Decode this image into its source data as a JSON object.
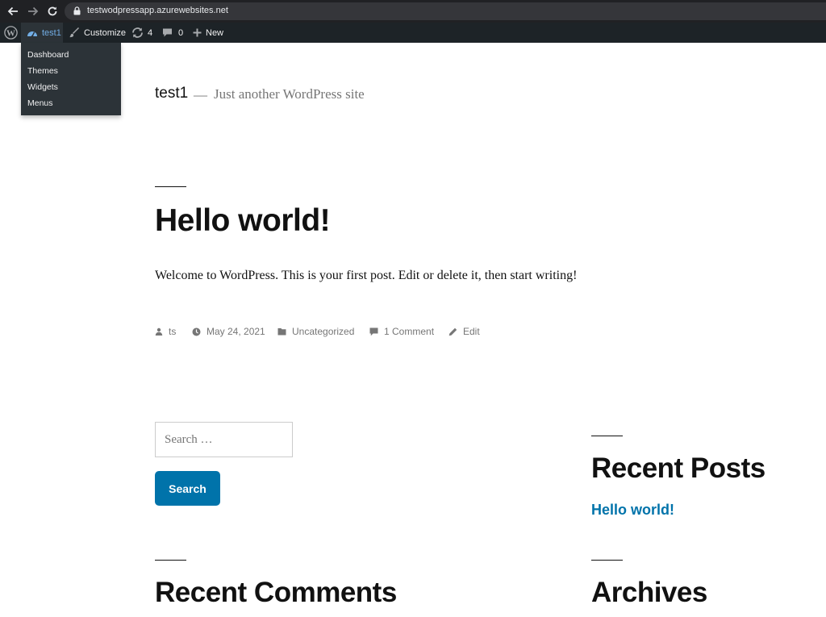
{
  "browser": {
    "url": "testwodpressapp.azurewebsites.net"
  },
  "admin_bar": {
    "site_name": "test1",
    "customize_label": "Customize",
    "updates_count": "4",
    "comments_count": "0",
    "new_label": "New",
    "dropdown_items": [
      "Dashboard",
      "Themes",
      "Widgets",
      "Menus"
    ]
  },
  "site": {
    "title": "test1",
    "separator": "—",
    "tagline": "Just another WordPress site"
  },
  "post": {
    "title": "Hello world!",
    "body": "Welcome to WordPress. This is your first post. Edit or delete it, then start writing!",
    "meta": {
      "author": "ts",
      "date": "May 24, 2021",
      "category": "Uncategorized",
      "comments": "1 Comment",
      "edit": "Edit"
    }
  },
  "search": {
    "placeholder": "Search …",
    "button_label": "Search"
  },
  "widgets": {
    "recent_posts_title": "Recent Posts",
    "recent_posts": [
      "Hello world!"
    ],
    "recent_comments_title": "Recent Comments",
    "archives_title": "Archives"
  },
  "colors": {
    "accent": "#0073aa",
    "admin_bar": "#1d2327",
    "admin_highlight": "#72aee6"
  }
}
